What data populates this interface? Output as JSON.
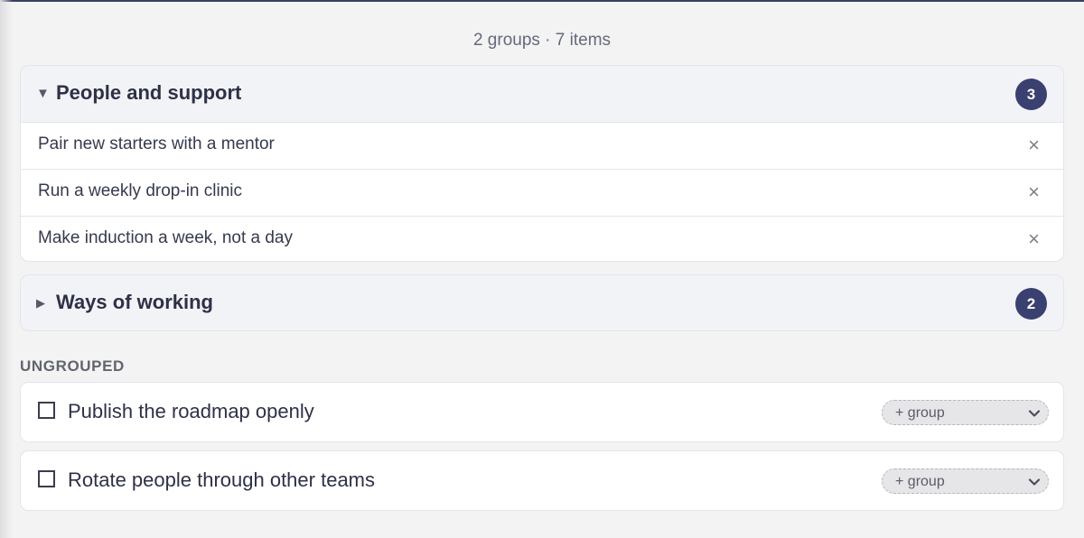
{
  "summary": {
    "text": "2 groups · 7 items"
  },
  "groups": [
    {
      "title": "People and support",
      "expanded": true,
      "caret": "▼",
      "count": "3",
      "items": [
        "Pair new starters with a mentor",
        "Run a weekly drop-in clinic",
        "Make induction a week, not a day"
      ]
    },
    {
      "title": "Ways of working",
      "expanded": false,
      "caret": "▶",
      "count": "2"
    }
  ],
  "remove_glyph": "×",
  "ungrouped": {
    "label": "UNGROUPED",
    "items": [
      {
        "text": "Publish the roadmap openly",
        "checked": false,
        "select_value": "+ group"
      },
      {
        "text": "Rotate people through other teams",
        "checked": false,
        "select_value": "+ group"
      }
    ]
  },
  "colors": {
    "accent": "#3a4070",
    "background": "#f3f3f4",
    "card": "#ffffff",
    "group_header": "#f2f3f7"
  },
  "icons": {
    "expand": "caret-down-icon",
    "collapse": "caret-right-icon",
    "remove": "close-icon",
    "select": "chevron-down-icon"
  }
}
